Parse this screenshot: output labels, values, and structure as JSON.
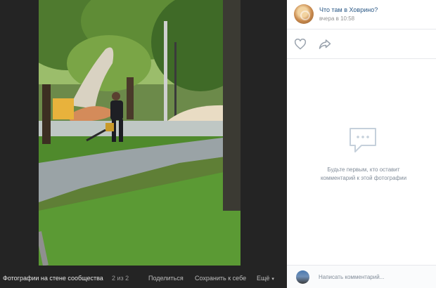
{
  "post": {
    "group_name": "Что там в Ховрино?",
    "time": "вчера в 10:58"
  },
  "empty_state": {
    "line1": "Будьте первым, кто оставит",
    "line2": "комментарий к этой фотографии"
  },
  "comment": {
    "placeholder": "Написать комментарий..."
  },
  "footer": {
    "album": "Фотографии на стене сообщества",
    "counter": "2 из 2",
    "share": "Поделиться",
    "save": "Сохранить к себе",
    "more": "Ещё"
  },
  "colors": {
    "link": "#2a5885",
    "muted": "#818c99",
    "icon": "#99a2ad"
  },
  "icons": {
    "like": "heart-icon",
    "share": "share-arrow-icon",
    "empty": "comment-bubble-icon",
    "more": "chevron-down-icon"
  }
}
